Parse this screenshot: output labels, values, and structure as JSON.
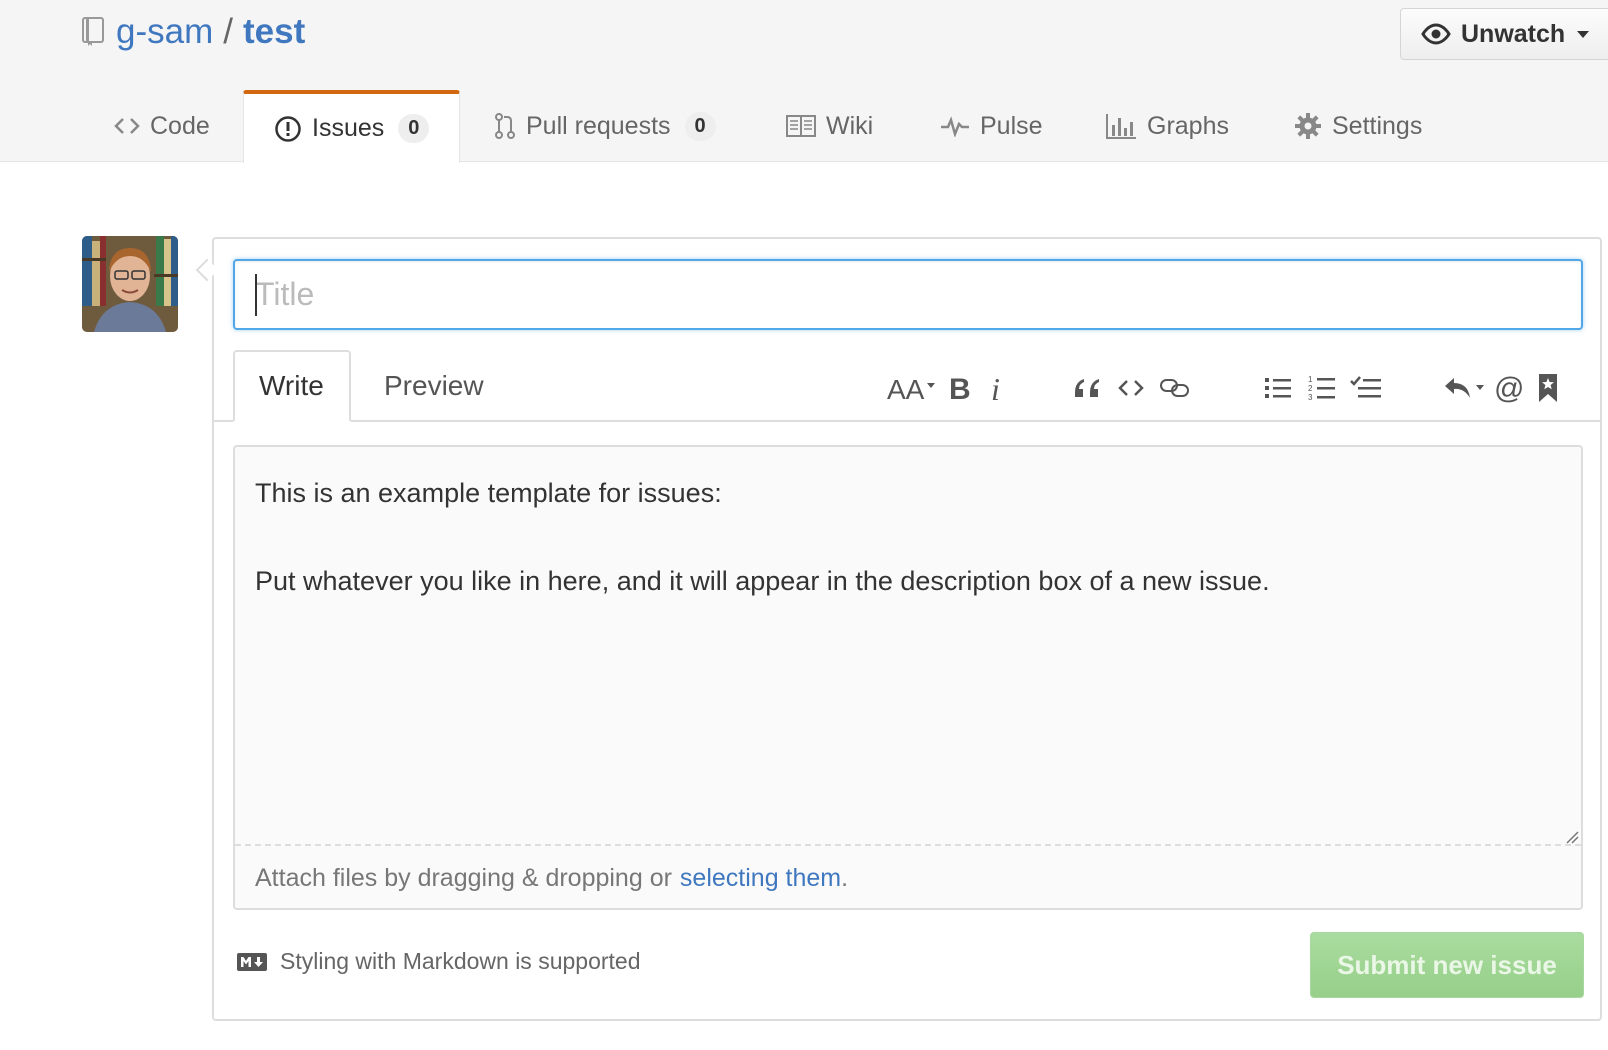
{
  "repo": {
    "owner": "g-sam",
    "separator": "/",
    "name": "test"
  },
  "watch": {
    "label": "Unwatch"
  },
  "nav": {
    "code": "Code",
    "issues": "Issues",
    "issues_count": "0",
    "pulls": "Pull requests",
    "pulls_count": "0",
    "wiki": "Wiki",
    "pulse": "Pulse",
    "graphs": "Graphs",
    "settings": "Settings"
  },
  "form": {
    "title_placeholder": "Title",
    "title_value": "",
    "tab_write": "Write",
    "tab_preview": "Preview",
    "body_lines": [
      "This is an example template for issues:",
      "Put whatever you like in here, and it will appear in the description box of a new issue."
    ],
    "attach_text": "Attach files by dragging & dropping or",
    "attach_link": "selecting them",
    "attach_suffix": ".",
    "markdown_note": "Styling with Markdown is supported",
    "submit_label": "Submit new issue"
  },
  "colors": {
    "link": "#4078c0",
    "selected_tab_border": "#d26911",
    "focus": "#51a7e8",
    "submit_disabled": "#a9dc9f"
  },
  "icons": [
    "repo-icon",
    "eye-icon",
    "code-icon",
    "issue-opened-icon",
    "git-pull-request-icon",
    "book-icon",
    "pulse-icon",
    "graph-icon",
    "gear-icon",
    "text-size-icon",
    "bold-icon",
    "italic-icon",
    "quote-icon",
    "code-icon",
    "link-icon",
    "list-unordered-icon",
    "list-ordered-icon",
    "tasklist-icon",
    "reply-icon",
    "mention-icon",
    "bookmark-icon",
    "markdown-icon"
  ]
}
